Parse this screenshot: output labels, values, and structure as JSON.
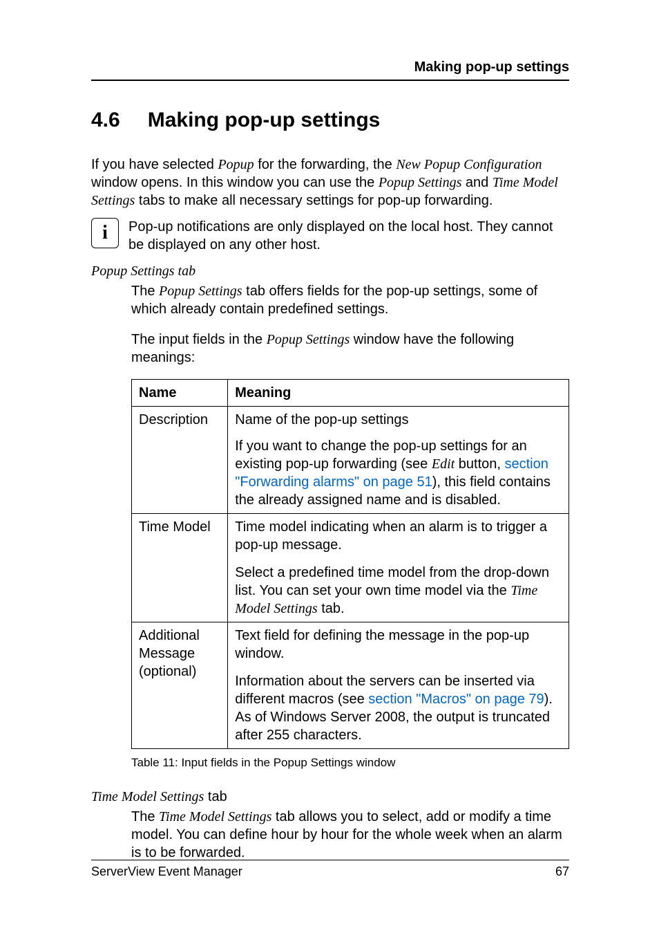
{
  "header": {
    "title": "Making pop-up settings"
  },
  "section": {
    "number": "4.6",
    "title": "Making pop-up settings"
  },
  "intro": {
    "part1": "If you have selected ",
    "popup_italic": "Popup",
    "part2": " for the forwarding, the ",
    "new_popup_config_italic": "New Popup Configuration",
    "part3": " window opens. In this window you can use the ",
    "popup_settings_italic": "Popup Settings",
    "part4": " and ",
    "time_model_settings_italic": "Time Model Settings",
    "part5": " tabs to make all necessary settings for pop-up forwarding."
  },
  "info_note": {
    "icon": "i",
    "text": "Pop-up notifications are only displayed on the local host. They cannot be displayed on any other host."
  },
  "popup_tab": {
    "heading": "Popup Settings tab",
    "para1_part1": "The ",
    "para1_italic": "Popup Settings",
    "para1_part2": " tab offers fields for the pop-up settings, some of which already contain predefined settings.",
    "para2_part1": "The input fields in the ",
    "para2_italic": "Popup Settings",
    "para2_part2": " window have the following meanings:"
  },
  "table": {
    "headers": {
      "name": "Name",
      "meaning": "Meaning"
    },
    "rows": {
      "description": {
        "name": "Description",
        "meaning1": "Name of the pop-up settings",
        "meaning2_part1": "If you want to change the pop-up settings for an existing pop-up forwarding (see ",
        "meaning2_italic": "Edit",
        "meaning2_part2": " button, ",
        "meaning2_link": "section \"Forwarding alarms\" on page 51",
        "meaning2_part3": "), this field contains the already assigned name and is disabled."
      },
      "time_model": {
        "name": "Time Model",
        "meaning1": "Time model indicating when an alarm is to trigger a pop-up message.",
        "meaning2_part1": "Select a predefined time model from the drop-down list. You can set your own time model via the ",
        "meaning2_italic": "Time Model Settings",
        "meaning2_part2": " tab."
      },
      "additional_message": {
        "name": "Additional Message (optional)",
        "meaning1": "Text field for defining the message in the pop-up window.",
        "meaning2_part1": "Information about the servers can be inserted via different macros (see ",
        "meaning2_link": "section \"Macros\" on page 79",
        "meaning2_part2": "). As of Windows Server 2008, the output is truncated after 255 characters."
      }
    },
    "caption": "Table 11: Input fields in the Popup Settings window"
  },
  "time_model_tab": {
    "heading_italic": "Time Model Settings",
    "heading_plain": " tab",
    "para_part1": "The ",
    "para_italic": "Time Model Settings",
    "para_part2": " tab allows you to select, add or modify a time model. You can define hour by hour for the whole week when an alarm is to be forwarded."
  },
  "footer": {
    "left": "ServerView Event Manager",
    "right": "67"
  }
}
